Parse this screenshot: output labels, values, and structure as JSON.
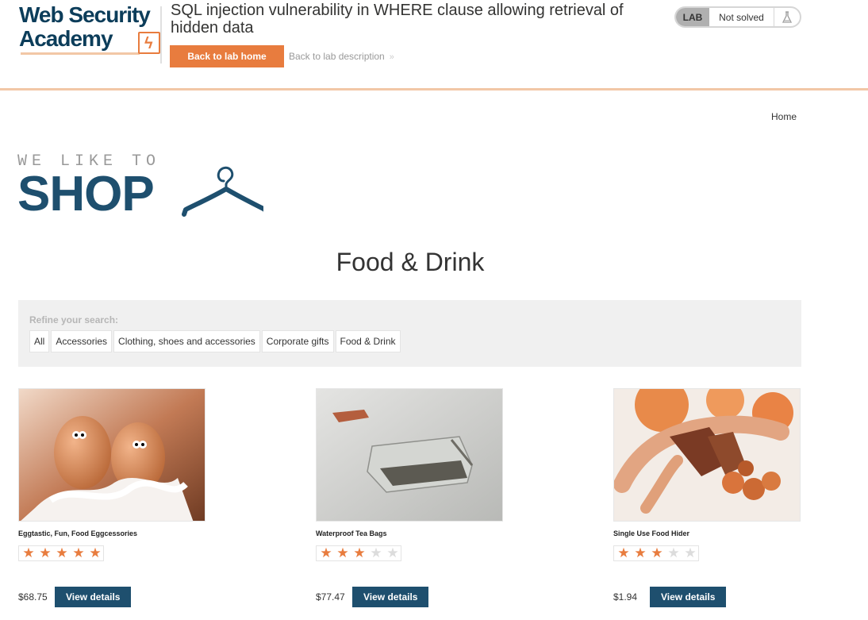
{
  "academy": {
    "logo_line1": "Web Security",
    "logo_line2": "Academy",
    "lab_title": "SQL injection vulnerability in WHERE clause allowing retrieval of hidden data",
    "back_home_label": "Back to lab home",
    "back_description_label": "Back to lab description",
    "status_tag": "LAB",
    "status_text": "Not solved",
    "status_icon": "flask-icon",
    "accent_color": "#e87c3e"
  },
  "nav": {
    "home_label": "Home"
  },
  "brand": {
    "tagline": "WE LIKE TO",
    "name": "SHOP",
    "color": "#1e4f6e"
  },
  "category_title": "Food & Drink",
  "filters": {
    "label": "Refine your search:",
    "items": [
      "All",
      "Accessories",
      "Clothing, shoes and accessories",
      "Corporate gifts",
      "Food & Drink"
    ]
  },
  "products": [
    {
      "name": "Eggtastic, Fun, Food Eggcessories",
      "rating": 5,
      "price": "$68.75",
      "button": "View details"
    },
    {
      "name": "Waterproof Tea Bags",
      "rating": 3,
      "price": "$77.47",
      "button": "View details"
    },
    {
      "name": "Single Use Food Hider",
      "rating": 3,
      "price": "$1.94",
      "button": "View details"
    }
  ]
}
